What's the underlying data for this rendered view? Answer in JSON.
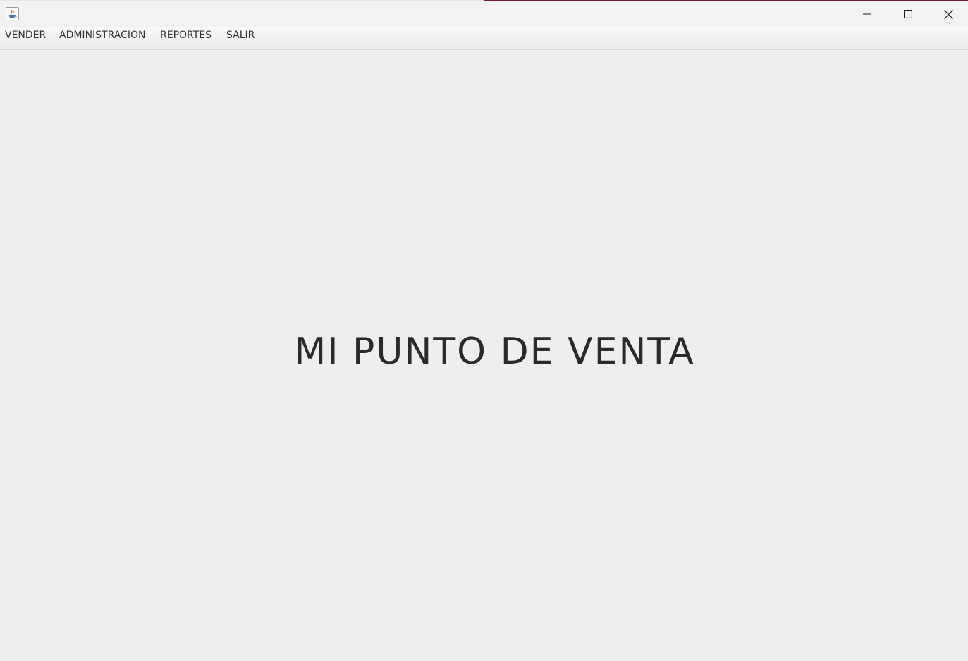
{
  "window": {
    "title": "",
    "controls": {
      "minimize_icon": "minimize-icon",
      "maximize_icon": "maximize-icon",
      "close_icon": "close-icon"
    },
    "app_icon": "java-cup-icon"
  },
  "menubar": {
    "items": [
      {
        "label": "VENDER"
      },
      {
        "label": "ADMINISTRACION"
      },
      {
        "label": "REPORTES"
      },
      {
        "label": "SALIR"
      }
    ]
  },
  "main": {
    "title": "MI PUNTO DE VENTA"
  },
  "colors": {
    "background": "#efeeee",
    "text": "#2a2a2a",
    "menu_text": "#333333"
  }
}
